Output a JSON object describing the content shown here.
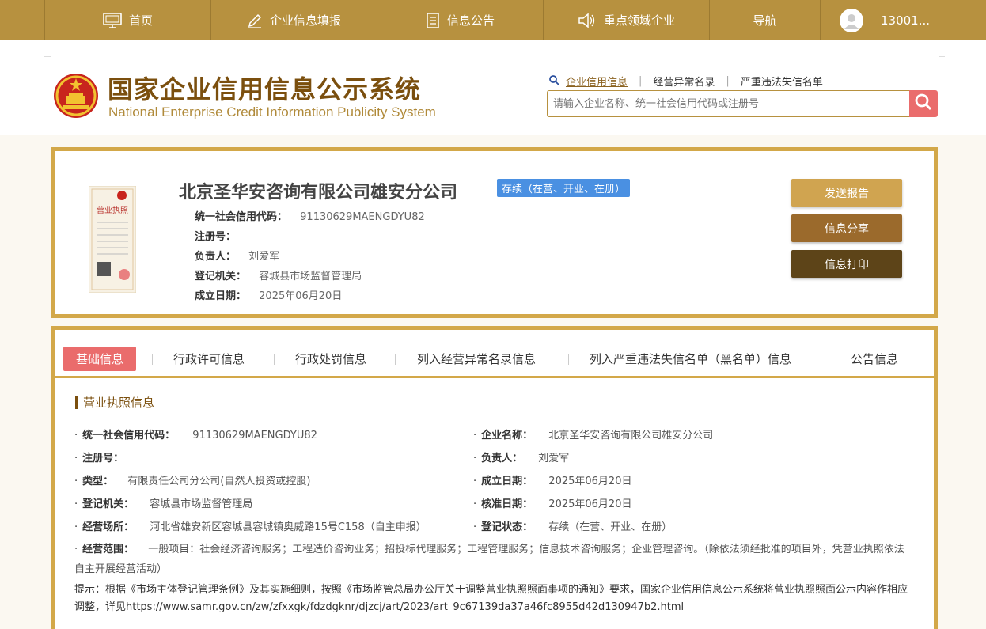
{
  "nav": {
    "home": "首页",
    "fill": "企业信息填报",
    "notice": "信息公告",
    "key": "重点领域企业",
    "guide": "导航",
    "user": "13001..."
  },
  "header": {
    "title_cn": "国家企业信用信息公示系统",
    "title_en": "National Enterprise Credit Information Publicity System",
    "search_tabs": [
      "企业信用信息",
      "经营异常名录",
      "严重违法失信名单"
    ],
    "search_placeholder": "请输入企业名称、统一社会信用代码或注册号"
  },
  "license_image": {
    "label": "营业执照"
  },
  "company": {
    "name": "北京圣华安咨询有限公司雄安分公司",
    "status": "存续（在营、开业、在册）",
    "credit_code_label": "统一社会信用代码：",
    "credit_code": "91130629MAENGDYU82",
    "reg_no_label": "注册号：",
    "reg_no": "",
    "manager_label": "负责人：",
    "manager": "刘爱军",
    "authority_label": "登记机关：",
    "authority": "容城县市场监督管理局",
    "date_label": "成立日期：",
    "date": "2025年06月20日"
  },
  "buttons": {
    "send": "发送报告",
    "share": "信息分享",
    "print": "信息打印"
  },
  "colors": {
    "send": "#d0a450",
    "share": "#9b6a2c",
    "print": "#5d4418"
  },
  "tabs": [
    "基础信息",
    "行政许可信息",
    "行政处罚信息",
    "列入经营异常名录信息",
    "列入严重违法失信名单（黑名单）信息",
    "公告信息"
  ],
  "detail": {
    "section_title": "营业执照信息",
    "fields": {
      "credit_code_label": "统一社会信用代码：",
      "credit_code": "91130629MAENGDYU82",
      "company_name_label": "企业名称：",
      "company_name": "北京圣华安咨询有限公司雄安分公司",
      "reg_no_label": "注册号：",
      "reg_no": "",
      "manager_label": "负责人：",
      "manager": "刘爱军",
      "type_label": "类型：",
      "type": "有限责任公司分公司(自然人投资或控股)",
      "est_date_label": "成立日期：",
      "est_date": "2025年06月20日",
      "authority_label": "登记机关：",
      "authority": "容城县市场监督管理局",
      "approve_date_label": "核准日期：",
      "approve_date": "2025年06月20日",
      "address_label": "经营场所：",
      "address": "河北省雄安新区容城县容城镇奥威路15号C158（自主申报）",
      "reg_status_label": "登记状态：",
      "reg_status": "存续（在营、开业、在册）",
      "scope_label": "经营范围：",
      "scope": "一般项目：社会经济咨询服务；工程造价咨询业务；招投标代理服务；工程管理服务；信息技术咨询服务；企业管理咨询。（除依法须经批准的项目外，凭营业执照依法自主开展经营活动）"
    },
    "tip": "提示：根据《市场主体登记管理条例》及其实施细则，按照《市场监管总局办公厅关于调整营业执照照面事项的通知》要求，国家企业信用信息公示系统将营业执照照面公示内容作相应调整，详见https://www.samr.gov.cn/zw/zfxxgk/fdzdgknr/djzcj/art/2023/art_9c67139da37a46fc8955d42d130947b2.html"
  }
}
